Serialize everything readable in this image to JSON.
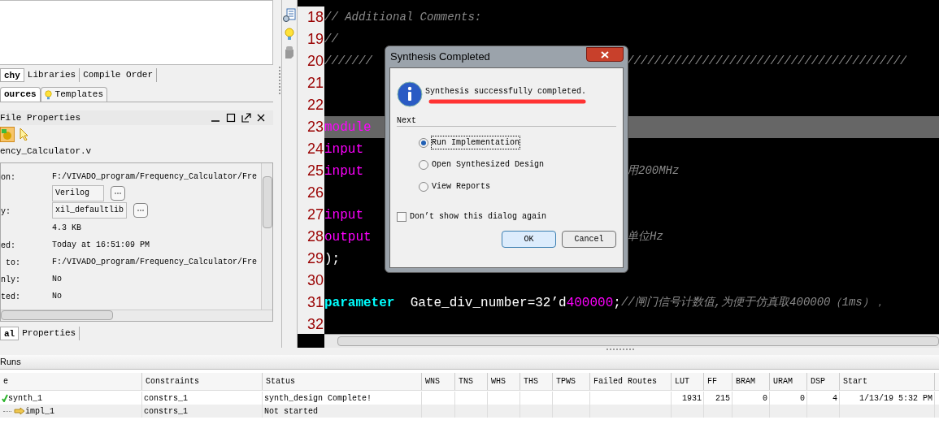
{
  "left_panel": {
    "source_tabs": [
      {
        "label": "chy",
        "selected": true
      },
      {
        "label": "Libraries",
        "selected": false
      },
      {
        "label": "Compile Order",
        "selected": false
      }
    ],
    "view_tabs": [
      {
        "label": "ources",
        "selected": true
      },
      {
        "label": "Templates",
        "selected": false
      }
    ],
    "properties": {
      "title": "File Properties",
      "file_name": "ency_Calculator.v",
      "rows": [
        {
          "kind": "text",
          "label": "on:",
          "value": "F:/VIVADO_program/Frequency_Calculator/Fre"
        },
        {
          "kind": "choice",
          "value": "Verilog"
        },
        {
          "kind": "choice",
          "label": "y:",
          "value": "xil_defaultlib"
        },
        {
          "kind": "text",
          "value": "4.3 KB"
        },
        {
          "kind": "text",
          "label": "ed:",
          "value": "Today at 16:51:09 PM"
        },
        {
          "kind": "text",
          "label": " to:",
          "value": "F:/VIVADO_program/Frequency_Calculator/Fre"
        },
        {
          "kind": "text",
          "label": "nly:",
          "value": "No"
        },
        {
          "kind": "text",
          "label": "ted:",
          "value": "No"
        }
      ]
    },
    "bottom_tabs": [
      {
        "label": "al",
        "selected": true
      },
      {
        "label": "Properties",
        "selected": false
      }
    ]
  },
  "editor": {
    "lines": [
      {
        "number": "18",
        "highlighted": false,
        "tokens": [
          {
            "kind": "comment",
            "text": "// Additional Comments:"
          }
        ]
      },
      {
        "number": "19",
        "highlighted": false,
        "tokens": [
          {
            "kind": "comment",
            "text": "//"
          }
        ]
      },
      {
        "number": "20",
        "highlighted": false,
        "tokens": [
          {
            "kind": "comment",
            "text": "///////"
          }
        ],
        "tail": [
          {
            "kind": "comment",
            "text": "/////////////////////////////////////////"
          }
        ]
      },
      {
        "number": "21",
        "highlighted": false
      },
      {
        "number": "22",
        "highlighted": false
      },
      {
        "number": "23",
        "highlighted": true,
        "tokens": [
          {
            "kind": "port",
            "text": "module"
          }
        ]
      },
      {
        "number": "24",
        "highlighted": false,
        "tokens": [
          {
            "kind": "port",
            "text": "input"
          }
        ]
      },
      {
        "number": "25",
        "highlighted": false,
        "tokens": [
          {
            "kind": "port",
            "text": "input"
          }
        ],
        "tail": [
          {
            "kind": "comment",
            "text": "用200MHz"
          }
        ]
      },
      {
        "number": "26",
        "highlighted": false
      },
      {
        "number": "27",
        "highlighted": false,
        "tokens": [
          {
            "kind": "port",
            "text": "input"
          }
        ]
      },
      {
        "number": "28",
        "highlighted": false,
        "tokens": [
          {
            "kind": "port",
            "text": "output"
          }
        ],
        "tail": [
          {
            "kind": "comment",
            "text": "单位Hz"
          }
        ]
      },
      {
        "number": "29",
        "highlighted": false,
        "tokens": [
          {
            "kind": "plain",
            "text": ");"
          }
        ]
      },
      {
        "number": "30",
        "highlighted": false
      },
      {
        "number": "31",
        "highlighted": false,
        "tokens": [
          {
            "kind": "keyword",
            "text": "parameter"
          },
          {
            "kind": "plain",
            "text": "  Gate_div_number=32’d"
          },
          {
            "kind": "number",
            "text": "400000"
          },
          {
            "kind": "plain",
            "text": ";"
          },
          {
            "kind": "comment",
            "text": "//闸门信号计数值,为便于仿真取400000（1ms），"
          }
        ]
      },
      {
        "number": "32",
        "highlighted": false
      }
    ]
  },
  "dialog": {
    "title": "Synthesis Completed",
    "message": "Synthesis successfully completed.",
    "group_label": "Next",
    "options": [
      {
        "label": "Run Implementation",
        "selected": true
      },
      {
        "label": "Open Synthesized Design",
        "selected": false
      },
      {
        "label": "View Reports",
        "selected": false
      }
    ],
    "dont_show": {
      "label": "Don’t show this dialog again",
      "checked": false
    },
    "buttons": [
      {
        "label": "OK",
        "default": true
      },
      {
        "label": "Cancel",
        "default": false
      }
    ]
  },
  "runs": {
    "title": "Runs",
    "columns": [
      "e",
      "Constraints",
      "Status",
      "WNS",
      "TNS",
      "WHS",
      "THS",
      "TPWS",
      "Failed Routes",
      "LUT",
      "FF",
      "BRAM",
      "URAM",
      "DSP",
      "Start"
    ],
    "rows": [
      {
        "done": true,
        "cells": [
          "synth_1",
          "constrs_1",
          "synth_design Complete!",
          null,
          null,
          null,
          null,
          null,
          null,
          "1931",
          "215",
          "0",
          "0",
          "4",
          "1/13/19 5:32 PM"
        ],
        "children": [
          {
            "done": false,
            "cells": [
              "impl_1",
              "constrs_1",
              "Not started",
              null,
              null,
              null,
              null,
              null,
              null,
              null,
              null,
              null,
              null,
              null,
              null
            ]
          }
        ]
      }
    ]
  }
}
